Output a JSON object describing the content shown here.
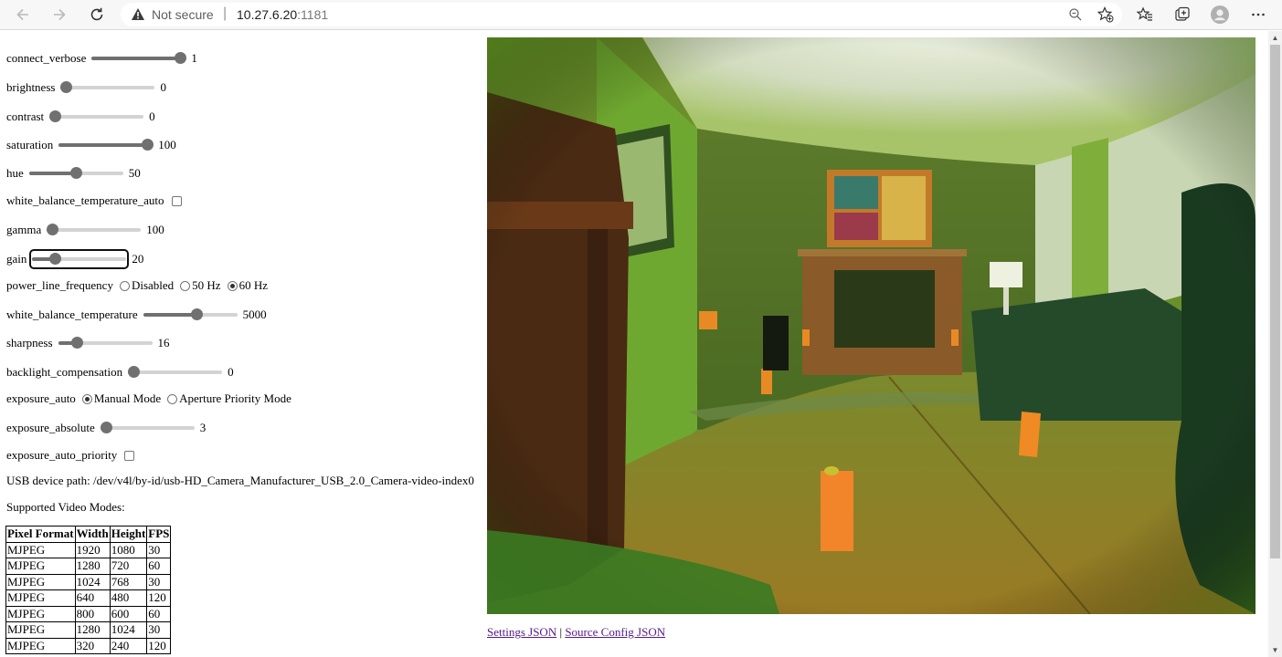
{
  "browser": {
    "security_label": "Not secure",
    "url_host": "10.27.6.20",
    "url_port": ":1181"
  },
  "controls": [
    {
      "type": "slider",
      "label": "connect_verbose",
      "value": "1",
      "fraction": 1.0
    },
    {
      "type": "slider",
      "label": "brightness",
      "value": "0",
      "fraction": 0.0
    },
    {
      "type": "slider",
      "label": "contrast",
      "value": "0",
      "fraction": 0.0
    },
    {
      "type": "slider",
      "label": "saturation",
      "value": "100",
      "fraction": 1.0
    },
    {
      "type": "slider",
      "label": "hue",
      "value": "50",
      "fraction": 0.5
    },
    {
      "type": "checkbox",
      "label": "white_balance_temperature_auto",
      "checked": false
    },
    {
      "type": "slider",
      "label": "gamma",
      "value": "100",
      "fraction": 0.0
    },
    {
      "type": "slider",
      "label": "gain",
      "value": "20",
      "fraction": 0.2,
      "focused": true
    },
    {
      "type": "radio",
      "label": "power_line_frequency",
      "options": [
        "Disabled",
        "50 Hz",
        "60 Hz"
      ],
      "selected": 2
    },
    {
      "type": "slider",
      "label": "white_balance_temperature",
      "value": "5000",
      "fraction": 0.57
    },
    {
      "type": "slider",
      "label": "sharpness",
      "value": "16",
      "fraction": 0.16
    },
    {
      "type": "slider",
      "label": "backlight_compensation",
      "value": "0",
      "fraction": 0.0
    },
    {
      "type": "radio",
      "label": "exposure_auto",
      "options": [
        "Manual Mode",
        "Aperture Priority Mode"
      ],
      "selected": 0
    },
    {
      "type": "slider",
      "label": "exposure_absolute",
      "value": "3",
      "fraction": 0.0
    },
    {
      "type": "checkbox",
      "label": "exposure_auto_priority",
      "checked": false
    }
  ],
  "usb_path_label": "USB device path: /dev/v4l/by-id/usb-HD_Camera_Manufacturer_USB_2.0_Camera-video-index0",
  "supported_modes_label": "Supported Video Modes:",
  "modes_table": {
    "headers": [
      "Pixel Format",
      "Width",
      "Height",
      "FPS"
    ],
    "rows": [
      [
        "MJPEG",
        "1920",
        "1080",
        "30"
      ],
      [
        "MJPEG",
        "1280",
        "720",
        "60"
      ],
      [
        "MJPEG",
        "1024",
        "768",
        "30"
      ],
      [
        "MJPEG",
        "640",
        "480",
        "120"
      ],
      [
        "MJPEG",
        "800",
        "600",
        "60"
      ],
      [
        "MJPEG",
        "1280",
        "1024",
        "30"
      ],
      [
        "MJPEG",
        "320",
        "240",
        "120"
      ]
    ]
  },
  "links": {
    "settings": "Settings JSON",
    "separator": "|",
    "source_config": "Source Config JSON"
  },
  "colors": {
    "slider_fill": "#707070",
    "slider_track": "#d3d3d3",
    "link": "#551a8b"
  }
}
